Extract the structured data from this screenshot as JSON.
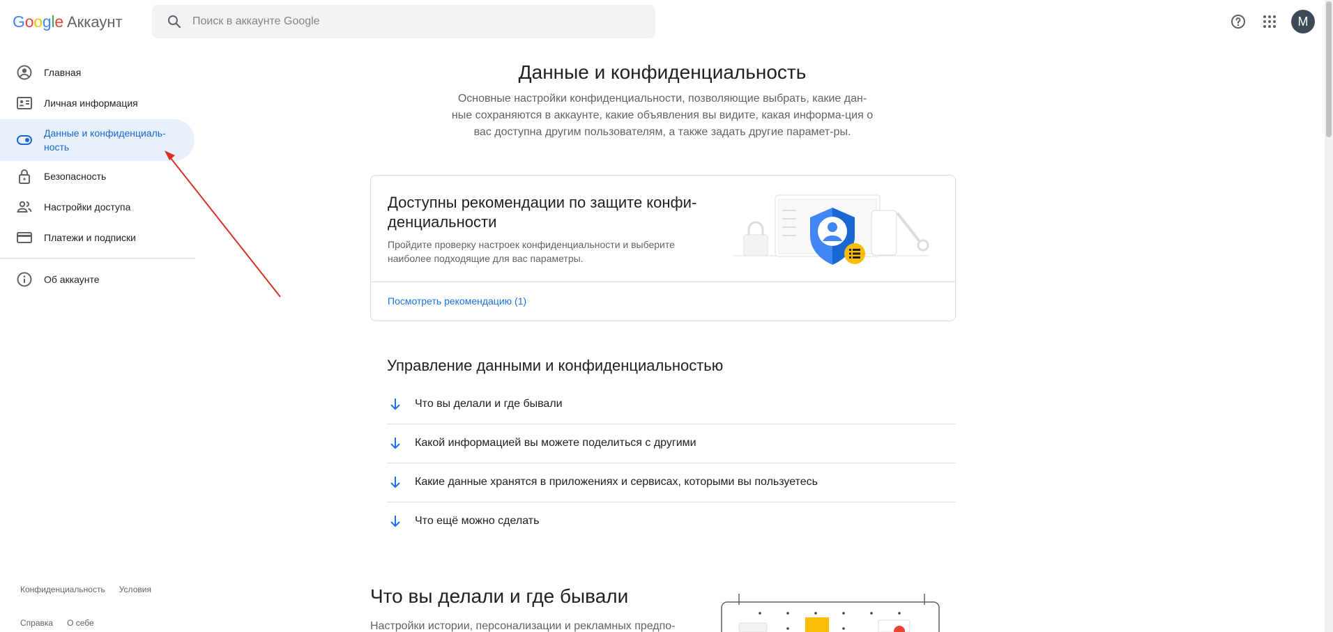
{
  "header": {
    "logo_google": "Google",
    "logo_account": "Аккаунт",
    "search_placeholder": "Поиск в аккаунте Google",
    "avatar_letter": "M"
  },
  "colors": {
    "google_blue": "#4285f4",
    "google_red": "#ea4335",
    "google_yellow": "#fbbc05",
    "google_green": "#34a853",
    "active_bg": "#e8f0fe",
    "active_text": "#1967d2",
    "link": "#1a73e8",
    "annotation": "#d93025"
  },
  "sidebar": {
    "items": [
      {
        "label": "Главная",
        "icon": "person-circle-icon"
      },
      {
        "label": "Личная информация",
        "icon": "id-card-icon"
      },
      {
        "label": "Данные и конфиденциаль-ность",
        "icon": "toggle-icon",
        "active": true
      },
      {
        "label": "Безопасность",
        "icon": "lock-icon"
      },
      {
        "label": "Настройки доступа",
        "icon": "people-icon"
      },
      {
        "label": "Платежи и подписки",
        "icon": "credit-card-icon"
      },
      {
        "label": "Об аккаунте",
        "icon": "info-icon"
      }
    ],
    "footer": {
      "privacy": "Конфиденциальность",
      "terms": "Условия",
      "help": "Справка",
      "about": "О себе"
    }
  },
  "main": {
    "title": "Данные и конфиденциальность",
    "description": "Основные настройки конфиденциальности, позволяющие выбрать, какие дан-ные сохраняются в аккаунте, какие объявления вы видите, какая информа-ция о вас доступна другим пользователям, а также задать другие парамет-ры.",
    "card": {
      "title": "Доступны рекомендации по защите конфи-денциальности",
      "text": "Пройдите проверку настроек конфиденциальности и выберите наиболее подходящие для вас параметры.",
      "link": "Посмотреть рекомендацию (1)"
    },
    "manage": {
      "title": "Управление данными и конфиденциальностью",
      "items": [
        "Что вы делали и где бывали",
        "Какой информацией вы можете поделиться с другими",
        "Какие данные хранятся в приложениях и сервисах, которыми вы пользуетесь",
        "Что ещё можно сделать"
      ]
    },
    "activity": {
      "title": "Что вы делали и где бывали",
      "description": "Настройки истории, персонализации и рекламных предпо-"
    }
  }
}
